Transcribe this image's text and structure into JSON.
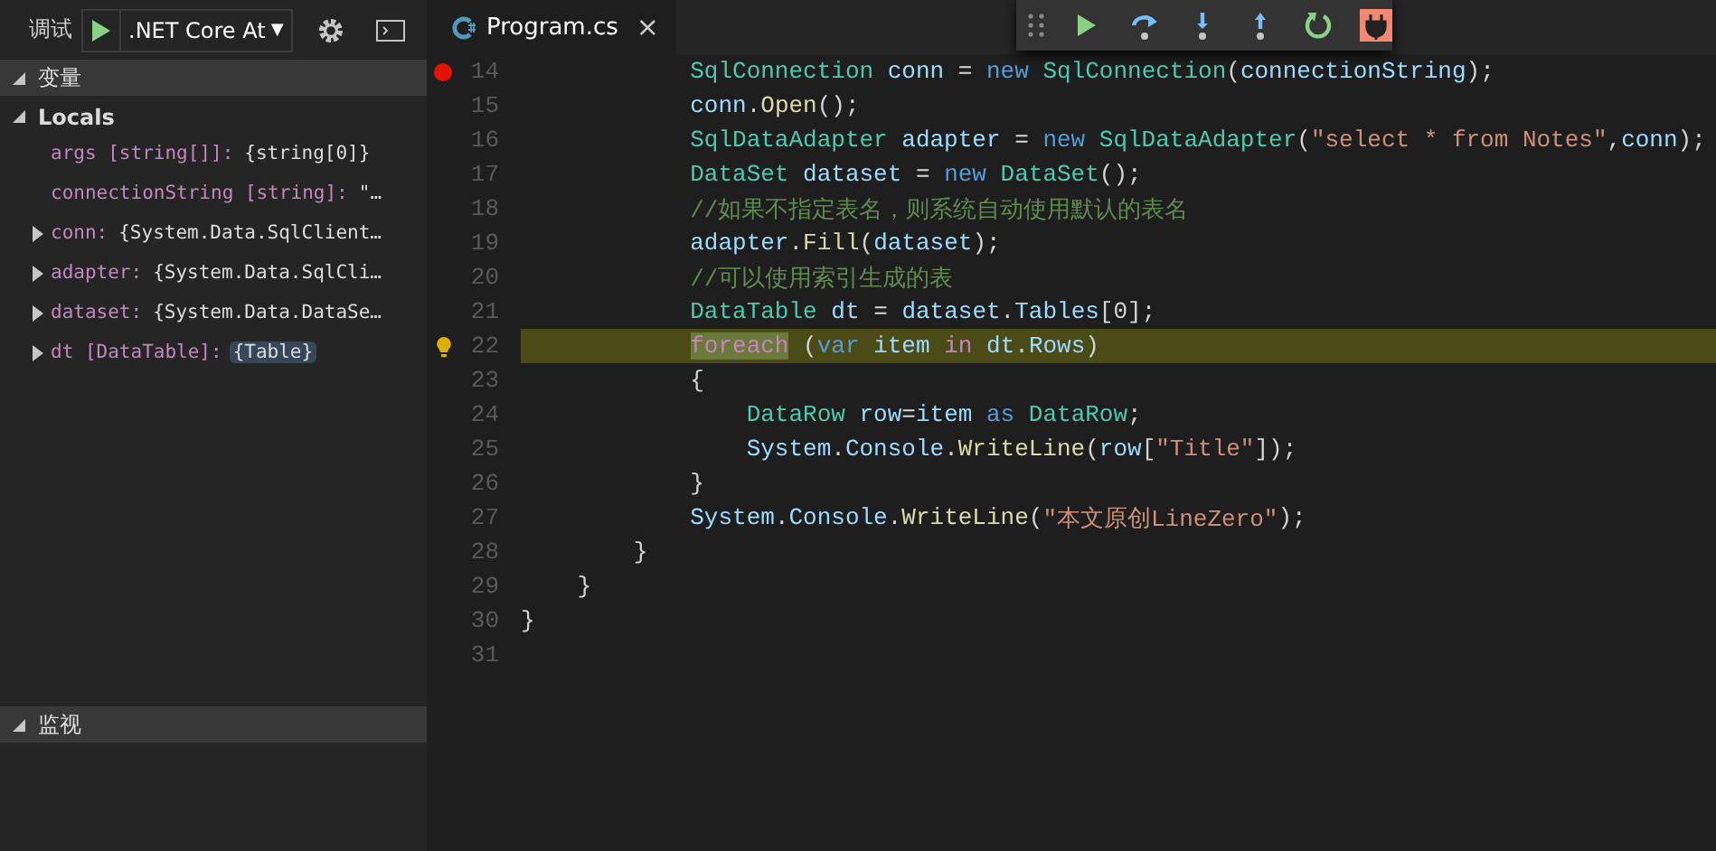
{
  "debug_bar": {
    "label": "调试",
    "configuration": ".NET Core At",
    "caret": "▼"
  },
  "variables": {
    "title": "变量",
    "expanded": true,
    "scope": {
      "title": "Locals",
      "expanded": true,
      "items": [
        {
          "label": "args [string[]]:",
          "value": "{string[0]}",
          "expandable": false,
          "changed": false
        },
        {
          "label": "connectionString [string]:",
          "value": "\"…",
          "expandable": false,
          "changed": false
        },
        {
          "label": "conn:",
          "value": "{System.Data.SqlClient…",
          "expandable": true,
          "changed": false
        },
        {
          "label": "adapter:",
          "value": "{System.Data.SqlCli…",
          "expandable": true,
          "changed": false
        },
        {
          "label": "dataset:",
          "value": "{System.Data.DataSe…",
          "expandable": true,
          "changed": false
        },
        {
          "label": "dt [DataTable]:",
          "value": "{Table}",
          "expandable": true,
          "changed": true
        }
      ]
    }
  },
  "watch": {
    "title": "监视",
    "expanded": true
  },
  "tabs": [
    {
      "label": "Program.cs",
      "selected": true,
      "close": "×"
    }
  ],
  "code_lines": [
    {
      "number": "14",
      "breakpoint": true,
      "lightbulb": false,
      "current": false,
      "tokens": [
        {
          "kind": "type",
          "text": "            SqlConnection"
        },
        {
          "kind": "variable",
          "text": " conn"
        },
        {
          "kind": "plain",
          "text": " = "
        },
        {
          "kind": "keyword",
          "text": "new"
        },
        {
          "kind": "type",
          "text": " SqlConnection"
        },
        {
          "kind": "plain",
          "text": "("
        },
        {
          "kind": "variable",
          "text": "connectionString"
        },
        {
          "kind": "plain",
          "text": ");"
        }
      ]
    },
    {
      "number": "15",
      "breakpoint": false,
      "lightbulb": false,
      "current": false,
      "tokens": [
        {
          "kind": "variable",
          "text": "            conn"
        },
        {
          "kind": "plain",
          "text": "."
        },
        {
          "kind": "method",
          "text": "Open"
        },
        {
          "kind": "plain",
          "text": "();"
        }
      ]
    },
    {
      "number": "16",
      "breakpoint": false,
      "lightbulb": false,
      "current": false,
      "tokens": [
        {
          "kind": "type",
          "text": "            SqlDataAdapter"
        },
        {
          "kind": "variable",
          "text": " adapter"
        },
        {
          "kind": "plain",
          "text": " = "
        },
        {
          "kind": "keyword",
          "text": "new"
        },
        {
          "kind": "type",
          "text": " SqlDataAdapter"
        },
        {
          "kind": "plain",
          "text": "("
        },
        {
          "kind": "string",
          "text": "\"select * from Notes\""
        },
        {
          "kind": "plain",
          "text": ","
        },
        {
          "kind": "variable",
          "text": "conn"
        },
        {
          "kind": "plain",
          "text": ");"
        }
      ]
    },
    {
      "number": "17",
      "breakpoint": false,
      "lightbulb": false,
      "current": false,
      "tokens": [
        {
          "kind": "type",
          "text": "            DataSet"
        },
        {
          "kind": "variable",
          "text": " dataset"
        },
        {
          "kind": "plain",
          "text": " = "
        },
        {
          "kind": "keyword",
          "text": "new"
        },
        {
          "kind": "type",
          "text": " DataSet"
        },
        {
          "kind": "plain",
          "text": "();"
        }
      ]
    },
    {
      "number": "18",
      "breakpoint": false,
      "lightbulb": false,
      "current": false,
      "tokens": [
        {
          "kind": "comment",
          "text": "            //如果不指定表名，则系统自动使用默认的表名"
        }
      ]
    },
    {
      "number": "19",
      "breakpoint": false,
      "lightbulb": false,
      "current": false,
      "tokens": [
        {
          "kind": "variable",
          "text": "            adapter"
        },
        {
          "kind": "plain",
          "text": "."
        },
        {
          "kind": "method",
          "text": "Fill"
        },
        {
          "kind": "plain",
          "text": "("
        },
        {
          "kind": "variable",
          "text": "dataset"
        },
        {
          "kind": "plain",
          "text": ");"
        }
      ]
    },
    {
      "number": "20",
      "breakpoint": false,
      "lightbulb": false,
      "current": false,
      "tokens": [
        {
          "kind": "comment",
          "text": "            //可以使用索引生成的表"
        }
      ]
    },
    {
      "number": "21",
      "breakpoint": false,
      "lightbulb": false,
      "current": false,
      "tokens": [
        {
          "kind": "type",
          "text": "            DataTable"
        },
        {
          "kind": "variable",
          "text": " dt"
        },
        {
          "kind": "plain",
          "text": " = "
        },
        {
          "kind": "variable",
          "text": "dataset"
        },
        {
          "kind": "plain",
          "text": "."
        },
        {
          "kind": "variable",
          "text": "Tables"
        },
        {
          "kind": "plain",
          "text": "[0];"
        }
      ]
    },
    {
      "number": "22",
      "breakpoint": false,
      "lightbulb": true,
      "current": true,
      "tokens": [
        {
          "kind": "control",
          "text": "            foreach",
          "highlighted": true
        },
        {
          "kind": "plain",
          "text": " ("
        },
        {
          "kind": "keyword",
          "text": "var"
        },
        {
          "kind": "variable",
          "text": " item"
        },
        {
          "kind": "control",
          "text": " in"
        },
        {
          "kind": "variable",
          "text": " dt"
        },
        {
          "kind": "plain",
          "text": "."
        },
        {
          "kind": "variable",
          "text": "Rows"
        },
        {
          "kind": "plain",
          "text": ")"
        }
      ]
    },
    {
      "number": "23",
      "breakpoint": false,
      "lightbulb": false,
      "current": false,
      "tokens": [
        {
          "kind": "plain",
          "text": "            {"
        }
      ]
    },
    {
      "number": "24",
      "breakpoint": false,
      "lightbulb": false,
      "current": false,
      "tokens": [
        {
          "kind": "type",
          "text": "                DataRow"
        },
        {
          "kind": "variable",
          "text": " row"
        },
        {
          "kind": "plain",
          "text": "="
        },
        {
          "kind": "variable",
          "text": "item"
        },
        {
          "kind": "keyword",
          "text": " as"
        },
        {
          "kind": "type",
          "text": " DataRow"
        },
        {
          "kind": "plain",
          "text": ";"
        }
      ]
    },
    {
      "number": "25",
      "breakpoint": false,
      "lightbulb": false,
      "current": false,
      "tokens": [
        {
          "kind": "variable",
          "text": "                System"
        },
        {
          "kind": "plain",
          "text": "."
        },
        {
          "kind": "variable",
          "text": "Console"
        },
        {
          "kind": "plain",
          "text": "."
        },
        {
          "kind": "method",
          "text": "WriteLine"
        },
        {
          "kind": "plain",
          "text": "("
        },
        {
          "kind": "variable",
          "text": "row"
        },
        {
          "kind": "plain",
          "text": "["
        },
        {
          "kind": "string",
          "text": "\"Title\""
        },
        {
          "kind": "plain",
          "text": "]);"
        }
      ]
    },
    {
      "number": "26",
      "breakpoint": false,
      "lightbulb": false,
      "current": false,
      "tokens": [
        {
          "kind": "plain",
          "text": "            }"
        }
      ]
    },
    {
      "number": "27",
      "breakpoint": false,
      "lightbulb": false,
      "current": false,
      "tokens": [
        {
          "kind": "variable",
          "text": "            System"
        },
        {
          "kind": "plain",
          "text": "."
        },
        {
          "kind": "variable",
          "text": "Console"
        },
        {
          "kind": "plain",
          "text": "."
        },
        {
          "kind": "method",
          "text": "WriteLine"
        },
        {
          "kind": "plain",
          "text": "("
        },
        {
          "kind": "string",
          "text": "\"本文原创LineZero\""
        },
        {
          "kind": "plain",
          "text": ");"
        }
      ]
    },
    {
      "number": "28",
      "breakpoint": false,
      "lightbulb": false,
      "current": false,
      "tokens": [
        {
          "kind": "plain",
          "text": "        }"
        }
      ]
    },
    {
      "number": "29",
      "breakpoint": false,
      "lightbulb": false,
      "current": false,
      "tokens": [
        {
          "kind": "plain",
          "text": "    }"
        }
      ]
    },
    {
      "number": "30",
      "breakpoint": false,
      "lightbulb": false,
      "current": false,
      "tokens": [
        {
          "kind": "plain",
          "text": "}"
        }
      ]
    },
    {
      "number": "31",
      "breakpoint": false,
      "lightbulb": false,
      "current": false
    }
  ],
  "debug_toolbar": [
    {
      "kind": "continue"
    },
    {
      "kind": "step-over"
    },
    {
      "kind": "step-into"
    },
    {
      "kind": "step-out"
    },
    {
      "kind": "restart"
    },
    {
      "kind": "disconnect"
    }
  ]
}
